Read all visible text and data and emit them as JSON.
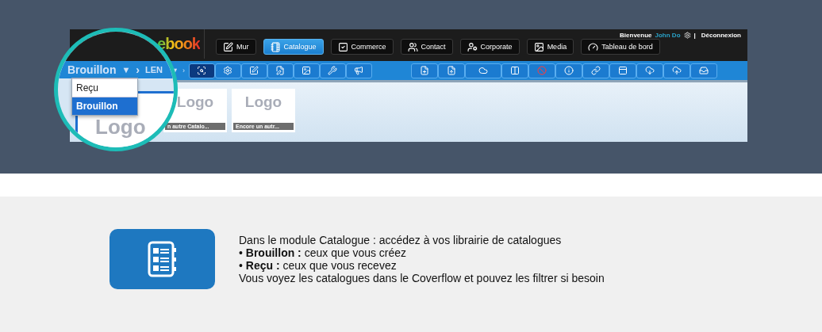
{
  "header": {
    "logo": "ebook",
    "welcome": "Bienvenue",
    "user": "John Do",
    "separator": "|",
    "logout": "Déconnexion"
  },
  "nav": [
    {
      "label": "Mur",
      "selected": false
    },
    {
      "label": "Catalogue",
      "selected": true
    },
    {
      "label": "Commerce",
      "selected": false
    },
    {
      "label": "Contact",
      "selected": false
    },
    {
      "label": "Corporate",
      "selected": false
    },
    {
      "label": "Media",
      "selected": false
    },
    {
      "label": "Tableau de bord",
      "selected": false
    }
  ],
  "toolbar": {
    "breadcrumb_tail": [
      "▼",
      "›"
    ],
    "tools": [
      {
        "selected": true
      },
      {
        "selected": false
      },
      {
        "selected": false
      },
      {
        "selected": false
      },
      {
        "selected": false
      },
      {
        "selected": false
      },
      {
        "selected": false
      }
    ]
  },
  "cards": [
    {
      "logo": "Logo",
      "label": "n autre Catalo..."
    },
    {
      "logo": "Logo",
      "label": "Encore un autr..."
    }
  ],
  "magnifier": {
    "breadcrumb": [
      "Brouillon",
      "▼",
      "›",
      "LEN"
    ],
    "dropdown": [
      {
        "label": "Reçu",
        "selected": false
      },
      {
        "label": "Brouillon",
        "selected": true
      }
    ],
    "card_logo": "Logo"
  },
  "info": {
    "lines": [
      "Dans le module Catalogue : accédez à vos librairie de catalogues",
      "• **Brouillon :** ceux que vous créez",
      "• **Reçu :** ceux que vous recevez",
      "Vous voyez les catalogues dans le Coverflow et pouvez les filtrer si besoin"
    ]
  }
}
